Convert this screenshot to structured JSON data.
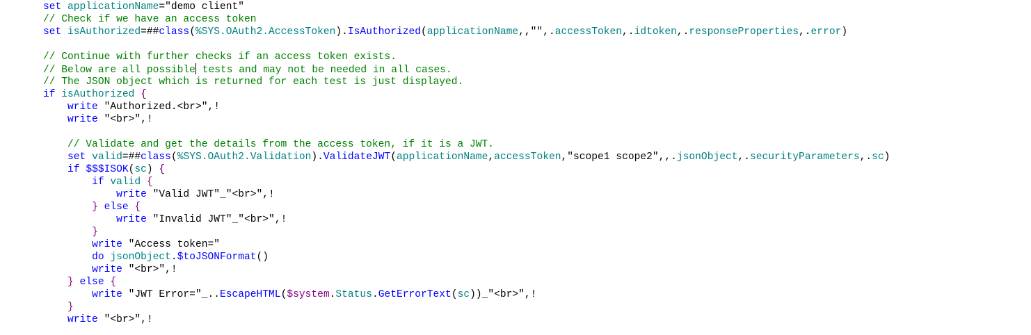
{
  "editor": {
    "lines": [
      [
        [
          "kw",
          "set "
        ],
        [
          "var",
          "applicationName"
        ],
        [
          "op",
          "="
        ],
        [
          "str",
          "\"demo client\""
        ]
      ],
      [
        [
          "cmt",
          "// Check if we have an access token"
        ]
      ],
      [
        [
          "kw",
          "set "
        ],
        [
          "var",
          "isAuthorized"
        ],
        [
          "op",
          "=##"
        ],
        [
          "kw",
          "class"
        ],
        [
          "op",
          "("
        ],
        [
          "cls",
          "%SYS.OAuth2.AccessToken"
        ],
        [
          "op",
          ")."
        ],
        [
          "mth",
          "IsAuthorized"
        ],
        [
          "op",
          "("
        ],
        [
          "var",
          "applicationName"
        ],
        [
          "op",
          ",,"
        ],
        [
          "str",
          "\"\""
        ],
        [
          "op",
          ",."
        ],
        [
          "var",
          "accessToken"
        ],
        [
          "op",
          ",."
        ],
        [
          "var",
          "idtoken"
        ],
        [
          "op",
          ",."
        ],
        [
          "var",
          "responseProperties"
        ],
        [
          "op",
          ",."
        ],
        [
          "var",
          "error"
        ],
        [
          "op",
          ")"
        ]
      ],
      [],
      [
        [
          "cmt",
          "// Continue with further checks if an access token exists."
        ]
      ],
      [
        [
          "cmt",
          "// Below are all possible"
        ],
        [
          "caret",
          ""
        ],
        [
          "cmt",
          " tests and may not be needed in all cases."
        ]
      ],
      [
        [
          "cmt",
          "// The JSON object which is returned for each test is just displayed."
        ]
      ],
      [
        [
          "kw",
          "if "
        ],
        [
          "var",
          "isAuthorized "
        ],
        [
          "brc",
          "{"
        ]
      ],
      [
        [
          "plain",
          "    "
        ],
        [
          "kw",
          "write "
        ],
        [
          "str",
          "\"Authorized.<br>\""
        ],
        [
          "op",
          ",!"
        ]
      ],
      [
        [
          "plain",
          "    "
        ],
        [
          "kw",
          "write "
        ],
        [
          "str",
          "\"<br>\""
        ],
        [
          "op",
          ",!"
        ]
      ],
      [],
      [
        [
          "plain",
          "    "
        ],
        [
          "cmt",
          "// Validate and get the details from the access token, if it is a JWT."
        ]
      ],
      [
        [
          "plain",
          "    "
        ],
        [
          "kw",
          "set "
        ],
        [
          "var",
          "valid"
        ],
        [
          "op",
          "=##"
        ],
        [
          "kw",
          "class"
        ],
        [
          "op",
          "("
        ],
        [
          "cls",
          "%SYS.OAuth2.Validation"
        ],
        [
          "op",
          ")."
        ],
        [
          "mth",
          "ValidateJWT"
        ],
        [
          "op",
          "("
        ],
        [
          "var",
          "applicationName"
        ],
        [
          "op",
          ","
        ],
        [
          "var",
          "accessToken"
        ],
        [
          "op",
          ","
        ],
        [
          "str",
          "\"scope1 scope2\""
        ],
        [
          "op",
          ",,."
        ],
        [
          "var",
          "jsonObject"
        ],
        [
          "op",
          ",."
        ],
        [
          "var",
          "securityParameters"
        ],
        [
          "op",
          ",."
        ],
        [
          "var",
          "sc"
        ],
        [
          "op",
          ")"
        ]
      ],
      [
        [
          "plain",
          "    "
        ],
        [
          "kw",
          "if "
        ],
        [
          "mth",
          "$$$ISOK"
        ],
        [
          "op",
          "("
        ],
        [
          "var",
          "sc"
        ],
        [
          "op",
          ") "
        ],
        [
          "brc",
          "{"
        ]
      ],
      [
        [
          "plain",
          "        "
        ],
        [
          "kw",
          "if "
        ],
        [
          "var",
          "valid "
        ],
        [
          "brc",
          "{"
        ]
      ],
      [
        [
          "plain",
          "            "
        ],
        [
          "kw",
          "write "
        ],
        [
          "str",
          "\"Valid JWT\""
        ],
        [
          "op",
          "_"
        ],
        [
          "str",
          "\"<br>\""
        ],
        [
          "op",
          ",!"
        ]
      ],
      [
        [
          "plain",
          "        "
        ],
        [
          "brc",
          "} "
        ],
        [
          "kw",
          "else "
        ],
        [
          "brc",
          "{"
        ]
      ],
      [
        [
          "plain",
          "            "
        ],
        [
          "kw",
          "write "
        ],
        [
          "str",
          "\"Invalid JWT\""
        ],
        [
          "op",
          "_"
        ],
        [
          "str",
          "\"<br>\""
        ],
        [
          "op",
          ",!"
        ]
      ],
      [
        [
          "plain",
          "        "
        ],
        [
          "brc",
          "}"
        ]
      ],
      [
        [
          "plain",
          "        "
        ],
        [
          "kw",
          "write "
        ],
        [
          "str",
          "\"Access token=\""
        ]
      ],
      [
        [
          "plain",
          "        "
        ],
        [
          "kw",
          "do "
        ],
        [
          "var",
          "jsonObject"
        ],
        [
          "op",
          "."
        ],
        [
          "mth",
          "$toJSONFormat"
        ],
        [
          "op",
          "()"
        ]
      ],
      [
        [
          "plain",
          "        "
        ],
        [
          "kw",
          "write "
        ],
        [
          "str",
          "\"<br>\""
        ],
        [
          "op",
          ",!"
        ]
      ],
      [
        [
          "plain",
          "    "
        ],
        [
          "brc",
          "} "
        ],
        [
          "kw",
          "else "
        ],
        [
          "brc",
          "{"
        ]
      ],
      [
        [
          "plain",
          "        "
        ],
        [
          "kw",
          "write "
        ],
        [
          "str",
          "\"JWT Error=\""
        ],
        [
          "op",
          "_.."
        ],
        [
          "mth",
          "EscapeHTML"
        ],
        [
          "op",
          "("
        ],
        [
          "sys",
          "$system"
        ],
        [
          "op",
          "."
        ],
        [
          "cls",
          "Status"
        ],
        [
          "op",
          "."
        ],
        [
          "mth",
          "GetErrorText"
        ],
        [
          "op",
          "("
        ],
        [
          "var",
          "sc"
        ],
        [
          "op",
          "))_"
        ],
        [
          "str",
          "\"<br>\""
        ],
        [
          "op",
          ",!"
        ]
      ],
      [
        [
          "plain",
          "    "
        ],
        [
          "brc",
          "}"
        ]
      ],
      [
        [
          "plain",
          "    "
        ],
        [
          "kw",
          "write "
        ],
        [
          "str",
          "\"<br>\""
        ],
        [
          "op",
          ",!"
        ]
      ]
    ]
  }
}
